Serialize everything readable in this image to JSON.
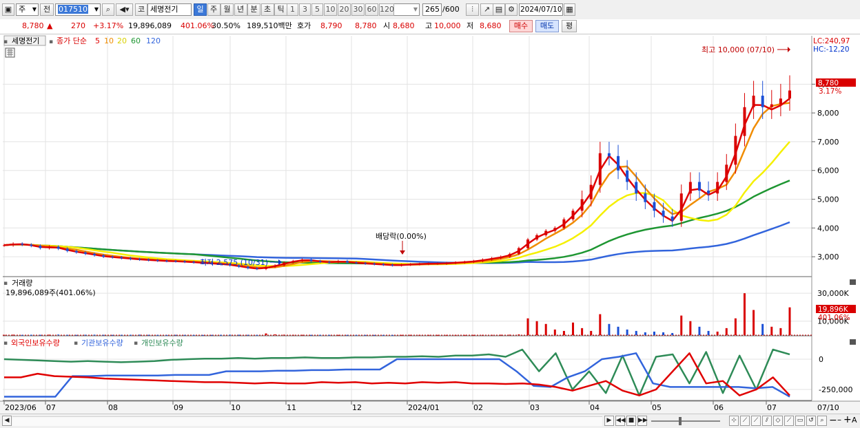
{
  "toolbar": {
    "market_type": "주",
    "prev_label": "전",
    "code": "017510",
    "stock_name_prefix": "코",
    "stock_name": "세명전기",
    "periods": [
      "일",
      "주",
      "월",
      "년",
      "분",
      "초",
      "틱"
    ],
    "active_period": "일",
    "intervals": [
      "1",
      "3",
      "5",
      "10",
      "20",
      "30",
      "60",
      "120"
    ],
    "count": "265",
    "count_total": "/600",
    "date": "2024/07/10"
  },
  "infobar": {
    "price": "8,780",
    "change": "270",
    "change_pct": "+3.17%",
    "volume": "19,896,089",
    "volume_pct": "401.06%",
    "turnover": "30.50%",
    "amount": "189,510백만",
    "quote_label": "호가",
    "ask": "8,790",
    "bid": "8,780",
    "open_label": "시",
    "open": "8,680",
    "high_label": "고",
    "high": "10,000",
    "low_label": "저",
    "low": "8,680",
    "buy_label": "매수",
    "sell_label": "매도",
    "eval_label": "평"
  },
  "price_panel": {
    "legend_name": "세명전기",
    "legend_close": "종가 단순",
    "ma_labels": [
      "5",
      "10",
      "20",
      "60",
      "120"
    ],
    "lc": "LC:240,97",
    "hc": "HC:-12,20",
    "high_annotation": "최고 10,000 (07/10)",
    "low_annotation": "최저 2,575 (10/31)",
    "dividend_annotation": "배당락(0.00%)",
    "current_price_tag": "8,780",
    "current_pct_tag": "3.17%",
    "y_ticks": [
      "9,000",
      "8,000",
      "7,000",
      "6,000",
      "5,000",
      "4,000",
      "3,000"
    ]
  },
  "volume_panel": {
    "title": "거래량",
    "value_line": "19,896,089주(401.06%)",
    "y_ticks": [
      "30,000K",
      "10,000K"
    ],
    "current_tag": "19,896K",
    "current_pct_tag": "401.06%"
  },
  "holdings_panel": {
    "series_labels": [
      "외국인보유수량",
      "기관보유수량",
      "개인보유수량"
    ],
    "y_ticks": [
      "0",
      "-250,000"
    ]
  },
  "x_axis": {
    "labels": [
      "2023/06",
      "07",
      "08",
      "09",
      "10",
      "11",
      "12",
      "2024/01",
      "02",
      "03",
      "04",
      "05",
      "06",
      "07"
    ],
    "end_label": "07/10"
  },
  "colors": {
    "up": "#d90000",
    "down": "#1a4fd6",
    "ma5": "#e00000",
    "ma10": "#f08c00",
    "ma20": "#f5f000",
    "ma60": "#1e9632",
    "ma120": "#3264dc",
    "foreign": "#e00000",
    "institution": "#3264dc",
    "individual": "#2e8b57"
  },
  "chart_data": [
    {
      "type": "line",
      "name": "price",
      "y_range": [
        2500,
        10300
      ],
      "close": [
        3400,
        3450,
        3420,
        3380,
        3300,
        3350,
        3280,
        3200,
        3150,
        3100,
        3050,
        3000,
        2980,
        2950,
        2920,
        2900,
        2880,
        2860,
        2850,
        2840,
        2820,
        2800,
        2780,
        2760,
        2740,
        2700,
        2650,
        2600,
        2575,
        2650,
        2700,
        2800,
        2850,
        2900,
        2850,
        2820,
        2800,
        2850,
        2800,
        2780,
        2760,
        2740,
        2720,
        2700,
        2720,
        2740,
        2750,
        2760,
        2760,
        2780,
        2800,
        2820,
        2850,
        2900,
        2950,
        3000,
        3100,
        3300,
        3600,
        3750,
        3900,
        4000,
        4300,
        4600,
        5000,
        5500,
        6600,
        6500,
        6000,
        5600,
        5200,
        4900,
        4600,
        4400,
        4250,
        5200,
        5600,
        5300,
        5200,
        5600,
        6200,
        7200,
        8200,
        8600,
        8200,
        8300,
        8500,
        8780
      ],
      "ma_current": {
        "ma5": 8500,
        "ma10": 8350,
        "ma20": 7000,
        "ma60": 5650,
        "ma120": 4200
      }
    },
    {
      "type": "bar",
      "name": "volume",
      "y_range": [
        0,
        36000
      ],
      "values_k": [
        200,
        300,
        150,
        250,
        200,
        300,
        400,
        200,
        150,
        250,
        300,
        200,
        150,
        200,
        250,
        300,
        200,
        150,
        100,
        200,
        150,
        120,
        100,
        150,
        200,
        300,
        250,
        200,
        150,
        1200,
        500,
        300,
        250,
        200,
        150,
        200,
        180,
        160,
        150,
        140,
        130,
        120,
        110,
        100,
        150,
        200,
        180,
        160,
        150,
        140,
        130,
        120,
        150,
        180,
        200,
        250,
        300,
        500,
        12000,
        10000,
        8000,
        4000,
        3000,
        9000,
        5000,
        3000,
        15000,
        8000,
        6000,
        4000,
        3000,
        2000,
        2500,
        2000,
        1500,
        14000,
        10000,
        6000,
        3000,
        2500,
        5000,
        12000,
        30000,
        18000,
        8000,
        6000,
        5000,
        19896
      ]
    },
    {
      "type": "line",
      "name": "holdings",
      "y_range": [
        -330000,
        80000
      ],
      "foreign": [
        -150000,
        -150000,
        -120000,
        -140000,
        -145000,
        -150000,
        -160000,
        -165000,
        -170000,
        -175000,
        -180000,
        -185000,
        -190000,
        -190000,
        -195000,
        -200000,
        -195000,
        -200000,
        -200000,
        -190000,
        -195000,
        -190000,
        -200000,
        -195000,
        -200000,
        -190000,
        -195000,
        -190000,
        -200000,
        -200000,
        -205000,
        -200000,
        -210000,
        -230000,
        -260000,
        -220000,
        -180000,
        -260000,
        -300000,
        -250000,
        -100000,
        50000,
        -200000,
        -180000,
        -300000,
        -250000,
        -150000,
        -300000
      ],
      "institution": [
        -310000,
        -310000,
        -310000,
        -310000,
        -140000,
        -140000,
        -135000,
        -135000,
        -135000,
        -135000,
        -130000,
        -130000,
        -130000,
        -100000,
        -100000,
        -100000,
        -95000,
        -95000,
        -90000,
        -90000,
        -85000,
        -85000,
        -85000,
        0,
        0,
        0,
        0,
        0,
        0,
        0,
        -100000,
        -220000,
        -230000,
        -150000,
        -100000,
        0,
        20000,
        50000,
        -200000,
        -230000,
        -230000,
        -230000,
        -230000,
        -230000,
        -240000,
        -230000,
        -310000
      ],
      "individual": [
        0,
        -5000,
        -10000,
        -15000,
        -20000,
        -15000,
        -20000,
        -25000,
        -20000,
        -15000,
        -5000,
        0,
        5000,
        5000,
        10000,
        5000,
        10000,
        10000,
        15000,
        10000,
        10000,
        15000,
        15000,
        20000,
        20000,
        25000,
        20000,
        30000,
        30000,
        40000,
        20000,
        80000,
        -100000,
        50000,
        -250000,
        -100000,
        -280000,
        30000,
        -300000,
        20000,
        40000,
        -200000,
        60000,
        -280000,
        30000,
        -250000,
        80000,
        40000
      ]
    }
  ]
}
